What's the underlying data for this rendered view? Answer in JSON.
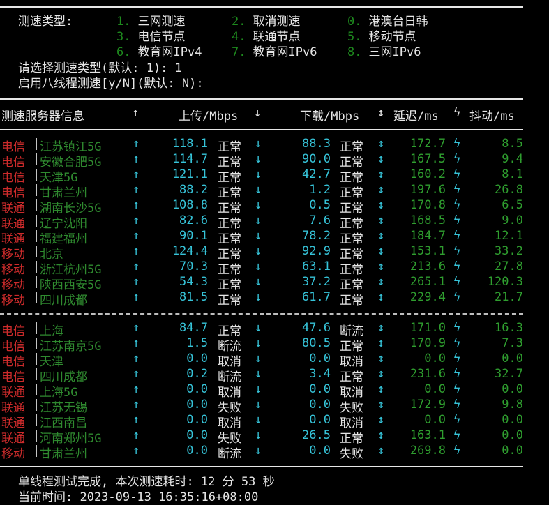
{
  "menu": {
    "label": "测速类型:",
    "options": [
      {
        "num": "1.",
        "text": "三网测速"
      },
      {
        "num": "2.",
        "text": "取消测速"
      },
      {
        "num": "0.",
        "text": "港澳台日韩"
      },
      {
        "num": "3.",
        "text": "电信节点"
      },
      {
        "num": "4.",
        "text": "联通节点"
      },
      {
        "num": "5.",
        "text": "移动节点"
      },
      {
        "num": "6.",
        "text": "教育网IPv4"
      },
      {
        "num": "7.",
        "text": "教育网IPv6"
      },
      {
        "num": "8.",
        "text": "三网IPv6"
      }
    ],
    "prompt1": "请选择测速类型(默认: 1): 1",
    "prompt2": "启用八线程测速[y/N](默认: N):"
  },
  "table": {
    "headers": {
      "server": "测速服务器信息",
      "upload_arrow": "↑",
      "upload": "上传/Mbps",
      "download_arrow": "↓",
      "download": "下载/Mbps",
      "latency_arrow": "↕",
      "latency": "延迟/ms",
      "jitter_arrow": "ϟ",
      "jitter": "抖动/ms"
    },
    "group1": [
      {
        "isp": "电信",
        "city": "江苏镇江5G",
        "up": "118.1",
        "up_status": "正常",
        "down": "88.3",
        "down_status": "正常",
        "lat": "172.7",
        "jit": "8.5"
      },
      {
        "isp": "电信",
        "city": "安徽合肥5G",
        "up": "114.7",
        "up_status": "正常",
        "down": "90.0",
        "down_status": "正常",
        "lat": "167.5",
        "jit": "9.4"
      },
      {
        "isp": "电信",
        "city": "天津5G",
        "up": "121.1",
        "up_status": "正常",
        "down": "42.7",
        "down_status": "正常",
        "lat": "160.2",
        "jit": "8.1"
      },
      {
        "isp": "电信",
        "city": "甘肃兰州",
        "up": "88.2",
        "up_status": "正常",
        "down": "1.2",
        "down_status": "正常",
        "lat": "197.6",
        "jit": "26.8"
      },
      {
        "isp": "联通",
        "city": "湖南长沙5G",
        "up": "108.8",
        "up_status": "正常",
        "down": "0.5",
        "down_status": "正常",
        "lat": "170.8",
        "jit": "6.5"
      },
      {
        "isp": "联通",
        "city": "辽宁沈阳",
        "up": "82.6",
        "up_status": "正常",
        "down": "7.6",
        "down_status": "正常",
        "lat": "168.5",
        "jit": "9.0"
      },
      {
        "isp": "联通",
        "city": "福建福州",
        "up": "90.1",
        "up_status": "正常",
        "down": "78.2",
        "down_status": "正常",
        "lat": "184.7",
        "jit": "12.1"
      },
      {
        "isp": "移动",
        "city": "北京",
        "up": "124.4",
        "up_status": "正常",
        "down": "92.9",
        "down_status": "正常",
        "lat": "153.1",
        "jit": "33.2"
      },
      {
        "isp": "移动",
        "city": "浙江杭州5G",
        "up": "70.3",
        "up_status": "正常",
        "down": "63.1",
        "down_status": "正常",
        "lat": "213.6",
        "jit": "27.8"
      },
      {
        "isp": "移动",
        "city": "陕西西安5G",
        "up": "54.3",
        "up_status": "正常",
        "down": "37.2",
        "down_status": "正常",
        "lat": "265.1",
        "jit": "120.3"
      },
      {
        "isp": "移动",
        "city": "四川成都",
        "up": "81.5",
        "up_status": "正常",
        "down": "61.7",
        "down_status": "正常",
        "lat": "229.4",
        "jit": "21.7"
      }
    ],
    "group2": [
      {
        "isp": "电信",
        "city": "上海",
        "up": "84.7",
        "up_status": "正常",
        "down": "47.6",
        "down_status": "断流",
        "lat": "171.0",
        "jit": "16.3"
      },
      {
        "isp": "电信",
        "city": "江苏南京5G",
        "up": "1.5",
        "up_status": "断流",
        "down": "80.5",
        "down_status": "正常",
        "lat": "170.9",
        "jit": "7.3"
      },
      {
        "isp": "电信",
        "city": "天津",
        "up": "0.0",
        "up_status": "取消",
        "down": "0.0",
        "down_status": "取消",
        "lat": "0.0",
        "jit": "0.0"
      },
      {
        "isp": "电信",
        "city": "四川成都",
        "up": "0.2",
        "up_status": "断流",
        "down": "3.4",
        "down_status": "正常",
        "lat": "231.6",
        "jit": "32.7"
      },
      {
        "isp": "联通",
        "city": "上海5G",
        "up": "0.0",
        "up_status": "取消",
        "down": "0.0",
        "down_status": "取消",
        "lat": "0.0",
        "jit": "0.0"
      },
      {
        "isp": "联通",
        "city": "江苏无锡",
        "up": "0.0",
        "up_status": "失败",
        "down": "0.0",
        "down_status": "失败",
        "lat": "172.9",
        "jit": "9.8"
      },
      {
        "isp": "联通",
        "city": "江西南昌",
        "up": "0.0",
        "up_status": "取消",
        "down": "0.0",
        "down_status": "取消",
        "lat": "0.0",
        "jit": "0.0"
      },
      {
        "isp": "联通",
        "city": "河南郑州5G",
        "up": "0.0",
        "up_status": "失败",
        "down": "26.5",
        "down_status": "正常",
        "lat": "163.1",
        "jit": "0.0"
      },
      {
        "isp": "移动",
        "city": "甘肃兰州",
        "up": "0.0",
        "up_status": "断流",
        "down": "0.0",
        "down_status": "失败",
        "lat": "269.8",
        "jit": "0.0"
      }
    ]
  },
  "footer": {
    "done": "单线程测试完成, 本次测速耗时: 12 分 53 秒",
    "time": "当前时间: 2023-09-13 16:35:16+08:00"
  }
}
